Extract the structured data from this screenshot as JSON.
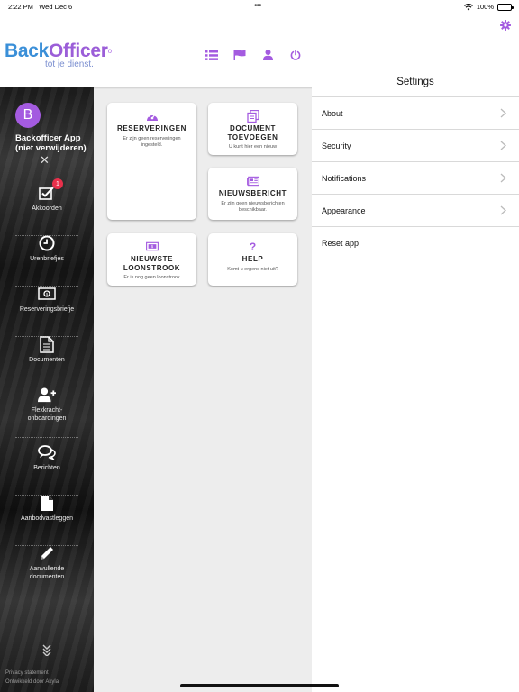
{
  "status_bar": {
    "time": "2:22 PM",
    "date": "Wed Dec 6",
    "battery": "100%",
    "battery_level": 1.0
  },
  "logo": {
    "part1": "Back",
    "part2": "Officer",
    "tagline": "tot je dienst."
  },
  "header_icons": [
    "list-icon",
    "flag-icon",
    "user-icon",
    "power-icon"
  ],
  "colors": {
    "accent": "#a45be0",
    "badge": "#e8304b",
    "logo_blue": "#3a8fd8"
  },
  "sidebar": {
    "avatar_letter": "B",
    "app_name": "Backofficer App (niet verwijderen)",
    "nav": [
      {
        "label": "Akkoorden",
        "icon": "check-square-icon",
        "badge": "1"
      },
      {
        "label": "Urenbriefjes",
        "icon": "clock-icon"
      },
      {
        "label": "Reserveringsbriefje",
        "icon": "money-icon"
      },
      {
        "label": "Documenten",
        "icon": "document-icon"
      },
      {
        "label": "Flexkracht-onboardingen",
        "icon": "user-plus-icon"
      },
      {
        "label": "Berichten",
        "icon": "chat-icon"
      },
      {
        "label": "Aanbodvastleggen",
        "icon": "file-icon"
      },
      {
        "label": "Aanvullende documenten",
        "icon": "pencil-icon"
      }
    ],
    "footer": {
      "privacy": "Privacy statement",
      "developed": "Ontwikkeld door Akyla"
    }
  },
  "tiles": {
    "reserveringen": {
      "title": "RESERVERINGEN",
      "desc": "Er zijn geen reserveringen ingesteld."
    },
    "document": {
      "title": "DOCUMENT TOEVOEGEN",
      "desc": "U kunt hier een nieuw"
    },
    "nieuws": {
      "title": "NIEUWSBERICHT",
      "desc": "Er zijn geen nieuwsberichten beschikbaar."
    },
    "loonstrook": {
      "title": "NIEUWSTE LOONSTROOK",
      "desc": "Er is nog geen loonstrook"
    },
    "help": {
      "title": "HELP",
      "desc": "Komt u ergens niet uit?"
    }
  },
  "settings": {
    "title": "Settings",
    "items": [
      "About",
      "Security",
      "Notifications",
      "Appearance",
      "Reset app"
    ]
  }
}
